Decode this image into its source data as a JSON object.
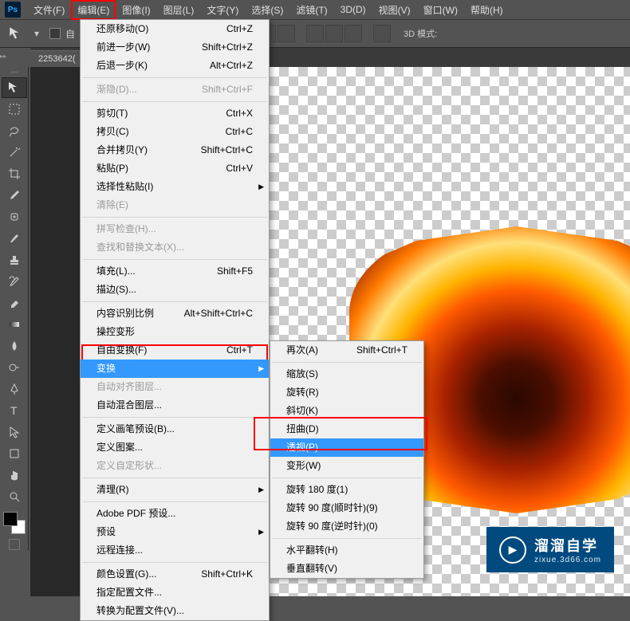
{
  "menubar": {
    "items": [
      "文件(F)",
      "编辑(E)",
      "图像(I)",
      "图层(L)",
      "文字(Y)",
      "选择(S)",
      "滤镜(T)",
      "3D(D)",
      "视图(V)",
      "窗口(W)",
      "帮助(H)"
    ],
    "highlighted_index": 1
  },
  "optionsbar": {
    "auto_select_label": "自",
    "mode3d": "3D 模式:"
  },
  "tab": {
    "title": "2253642("
  },
  "edit_menu": {
    "items": [
      {
        "label": "还原移动(O)",
        "shortcut": "Ctrl+Z"
      },
      {
        "label": "前进一步(W)",
        "shortcut": "Shift+Ctrl+Z"
      },
      {
        "label": "后退一步(K)",
        "shortcut": "Alt+Ctrl+Z"
      },
      {
        "sep": true
      },
      {
        "label": "渐隐(D)...",
        "shortcut": "Shift+Ctrl+F",
        "disabled": true
      },
      {
        "sep": true
      },
      {
        "label": "剪切(T)",
        "shortcut": "Ctrl+X"
      },
      {
        "label": "拷贝(C)",
        "shortcut": "Ctrl+C"
      },
      {
        "label": "合并拷贝(Y)",
        "shortcut": "Shift+Ctrl+C"
      },
      {
        "label": "粘贴(P)",
        "shortcut": "Ctrl+V"
      },
      {
        "label": "选择性粘贴(I)",
        "submenu": true
      },
      {
        "label": "清除(E)",
        "disabled": true
      },
      {
        "sep": true
      },
      {
        "label": "拼写检查(H)...",
        "disabled": true
      },
      {
        "label": "查找和替换文本(X)...",
        "disabled": true
      },
      {
        "sep": true
      },
      {
        "label": "填充(L)...",
        "shortcut": "Shift+F5"
      },
      {
        "label": "描边(S)..."
      },
      {
        "sep": true
      },
      {
        "label": "内容识别比例",
        "shortcut": "Alt+Shift+Ctrl+C"
      },
      {
        "label": "操控变形"
      },
      {
        "label": "自由变换(F)",
        "shortcut": "Ctrl+T"
      },
      {
        "label": "变换",
        "submenu": true,
        "highlighted": true
      },
      {
        "label": "自动对齐图层...",
        "disabled": true
      },
      {
        "label": "自动混合图层..."
      },
      {
        "sep": true
      },
      {
        "label": "定义画笔预设(B)..."
      },
      {
        "label": "定义图案..."
      },
      {
        "label": "定义自定形状...",
        "disabled": true
      },
      {
        "sep": true
      },
      {
        "label": "清理(R)",
        "submenu": true
      },
      {
        "sep": true
      },
      {
        "label": "Adobe PDF 预设..."
      },
      {
        "label": "预设",
        "submenu": true
      },
      {
        "label": "远程连接..."
      },
      {
        "sep": true
      },
      {
        "label": "颜色设置(G)...",
        "shortcut": "Shift+Ctrl+K"
      },
      {
        "label": "指定配置文件..."
      },
      {
        "label": "转换为配置文件(V)..."
      }
    ]
  },
  "transform_submenu": {
    "items": [
      {
        "label": "再次(A)",
        "shortcut": "Shift+Ctrl+T"
      },
      {
        "sep": true
      },
      {
        "label": "缩放(S)"
      },
      {
        "label": "旋转(R)"
      },
      {
        "label": "斜切(K)"
      },
      {
        "label": "扭曲(D)"
      },
      {
        "label": "透视(P)",
        "highlighted": true
      },
      {
        "label": "变形(W)"
      },
      {
        "sep": true
      },
      {
        "label": "旋转 180 度(1)"
      },
      {
        "label": "旋转 90 度(顺时针)(9)"
      },
      {
        "label": "旋转 90 度(逆时针)(0)"
      },
      {
        "sep": true
      },
      {
        "label": "水平翻转(H)"
      },
      {
        "label": "垂直翻转(V)"
      }
    ]
  },
  "tools": [
    "move",
    "marquee",
    "lasso",
    "wand",
    "crop",
    "eyedropper",
    "healing",
    "brush",
    "stamp",
    "history",
    "eraser",
    "gradient",
    "blur",
    "dodge",
    "pen",
    "type",
    "path-select",
    "rectangle",
    "hand",
    "zoom"
  ],
  "watermark": {
    "title": "溜溜自学",
    "url": "zixue.3d66.com"
  }
}
